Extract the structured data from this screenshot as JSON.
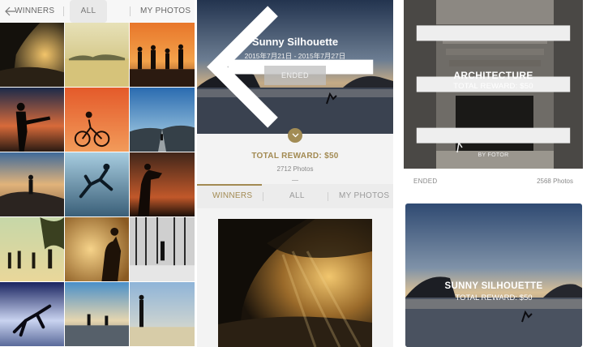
{
  "gallery_panel": {
    "tabs": {
      "winners": "WINNERS",
      "all": "ALL",
      "my_photos": "MY PHOTOS"
    },
    "active_tab": "ALL"
  },
  "contest_detail": {
    "title": "Sunny Silhouette",
    "dates": "2015年7月21日 - 2015年7月27日",
    "status_button": "ENDED",
    "total_reward": "TOTAL REWARD: $50",
    "photo_count": "2712 Photos",
    "tabs": {
      "winners": "WINNERS",
      "all": "ALL",
      "my_photos": "MY PHOTOS"
    },
    "active_tab": "WINNERS",
    "accent_color": "#a28a52"
  },
  "contest_list": {
    "cards": [
      {
        "title": "ARCHITECTURE",
        "reward": "TOTAL REWARD: $50",
        "byline": "BY FOTOR",
        "status": "ENDED",
        "photos": "2568 Photos"
      },
      {
        "title": "SUNNY SILHOUETTE",
        "reward": "TOTAL REWARD: $50"
      }
    ]
  },
  "icons": [
    "back-arrow-icon",
    "chevron-down-icon",
    "menu-icon"
  ]
}
